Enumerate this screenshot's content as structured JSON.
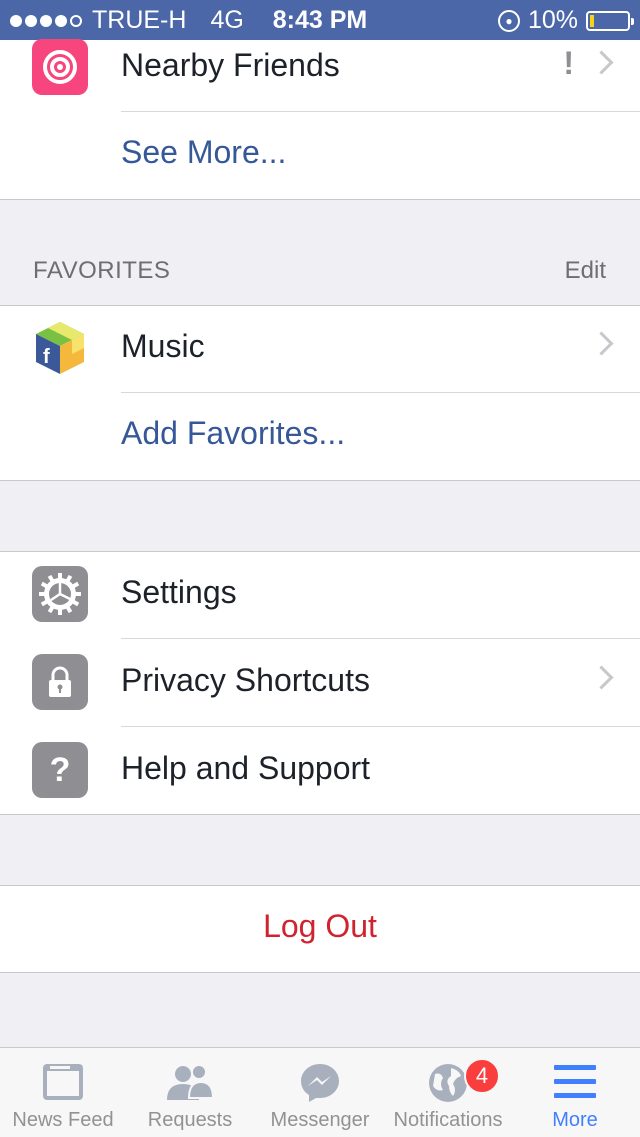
{
  "status_bar": {
    "carrier": "TRUE-H",
    "network": "4G",
    "time": "8:43 PM",
    "battery": "10%",
    "battery_level": 0.1,
    "signal_bars_filled": 4,
    "signal_bars_total": 5
  },
  "top_section": {
    "nearby": {
      "label": "Nearby Friends",
      "alert": "!",
      "icon": "target-icon",
      "icon_color": "#f7467e"
    },
    "see_more": "See More..."
  },
  "favorites": {
    "header": "FAVORITES",
    "edit": "Edit",
    "music": {
      "label": "Music",
      "icon": "facebook-app-cube-icon"
    },
    "add": "Add Favorites..."
  },
  "settings_section": {
    "settings": {
      "label": "Settings",
      "icon": "gear-icon"
    },
    "privacy": {
      "label": "Privacy Shortcuts",
      "icon": "lock-icon"
    },
    "help": {
      "label": "Help and Support",
      "icon": "question-icon"
    }
  },
  "logout": {
    "label": "Log Out",
    "color": "#d0232e"
  },
  "tabbar": {
    "tabs": [
      {
        "label": "News Feed",
        "icon": "news-feed-icon",
        "active": false
      },
      {
        "label": "Requests",
        "icon": "friend-requests-icon",
        "active": false
      },
      {
        "label": "Messenger",
        "icon": "messenger-icon",
        "active": false
      },
      {
        "label": "Notifications",
        "icon": "globe-icon",
        "badge": "4",
        "active": false
      },
      {
        "label": "More",
        "icon": "menu-icon",
        "active": true
      }
    ],
    "active_color": "#4080ff"
  },
  "colors": {
    "status_bar": "#4b67a8",
    "link": "#365899",
    "background": "#efeff4"
  }
}
